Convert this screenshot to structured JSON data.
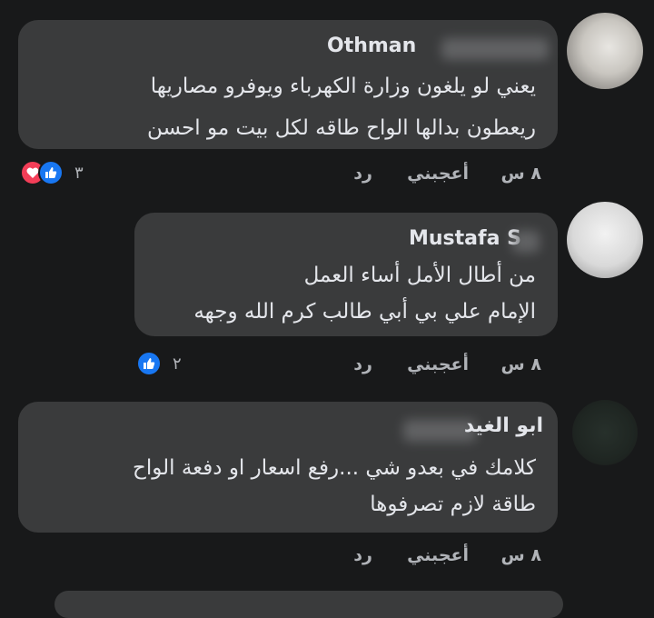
{
  "colors": {
    "background": "#18191a",
    "bubble": "#3a3b3c",
    "muted": "#b0b3b8",
    "like_blue": "#1877f2",
    "love_red": "#f33e58"
  },
  "comments": [
    {
      "author": "Othman",
      "lines": [
        "يعني لو يلغون وزارة الكهرباء ويوفرو مصاريها",
        "ريعطون بدالها الواح طاقه لكل بيت مو احسن"
      ],
      "time": "٨ س",
      "like": "أعجبني",
      "reply": "رد",
      "reaction_count": "٣",
      "reaction_icons": [
        "love-icon",
        "like-icon"
      ]
    },
    {
      "author": "Mustafa S",
      "lines": [
        "من أطال الأمل أساء العمل",
        "الإمام علي بي أبي طالب كرم الله وجهه"
      ],
      "time": "٨ س",
      "like": "أعجبني",
      "reply": "رد",
      "reaction_count": "٢",
      "reaction_icons": [
        "like-icon"
      ]
    },
    {
      "author": "ابو الغيد",
      "lines": [
        "كلامك في بعدو شي ...رفع اسعار او دفعة الواح",
        "طاقة لازم تصرفوها"
      ],
      "time": "٨ س",
      "like": "أعجبني",
      "reply": "رد"
    }
  ]
}
